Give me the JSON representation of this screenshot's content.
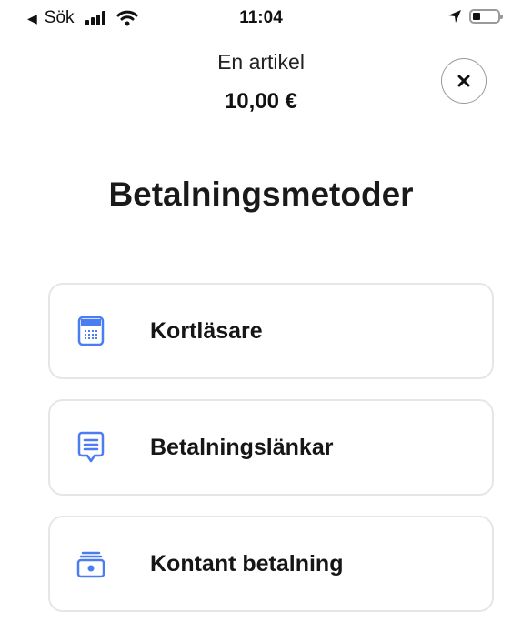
{
  "status_bar": {
    "back_label": "Sök",
    "time": "11:04",
    "back_triangle": "◀"
  },
  "header": {
    "summary_label": "En artikel",
    "amount": "10,00 €",
    "close_label": "×"
  },
  "page_title": "Betalningsmetoder",
  "payment_methods": [
    {
      "label": "Kortläsare",
      "icon": "card-reader-icon"
    },
    {
      "label": "Betalningslänkar",
      "icon": "payment-link-icon"
    },
    {
      "label": "Kontant betalning",
      "icon": "cash-icon"
    }
  ],
  "colors": {
    "accent": "#4a7df0",
    "card_border": "#e6e6e6",
    "text": "#161616"
  }
}
